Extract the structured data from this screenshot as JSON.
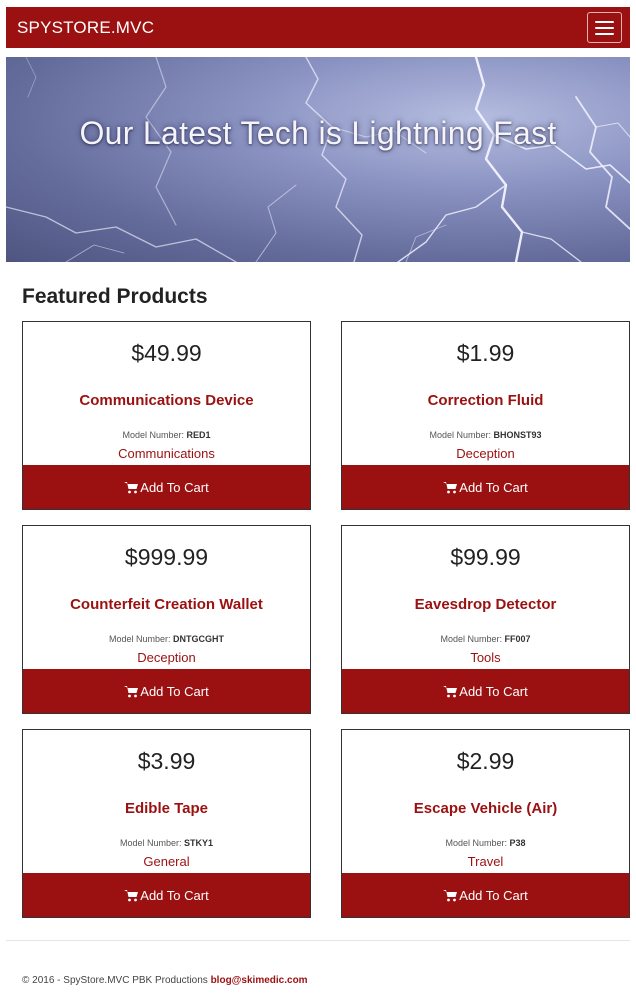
{
  "navbar": {
    "brand": "SPYSTORE.MVC"
  },
  "hero": {
    "headline": "Our Latest Tech is Lightning Fast"
  },
  "featured": {
    "title": "Featured Products",
    "model_label": "Model Number:",
    "add_to_cart_label": "Add To Cart",
    "products": [
      {
        "price": "$49.99",
        "name": "Communications Device",
        "model": "RED1",
        "category": "Communications"
      },
      {
        "price": "$1.99",
        "name": "Correction Fluid",
        "model": "BHONST93",
        "category": "Deception"
      },
      {
        "price": "$999.99",
        "name": "Counterfeit Creation Wallet",
        "model": "DNTGCGHT",
        "category": "Deception"
      },
      {
        "price": "$99.99",
        "name": "Eavesdrop Detector",
        "model": "FF007",
        "category": "Tools"
      },
      {
        "price": "$3.99",
        "name": "Edible Tape",
        "model": "STKY1",
        "category": "General"
      },
      {
        "price": "$2.99",
        "name": "Escape Vehicle (Air)",
        "model": "P38",
        "category": "Travel"
      }
    ]
  },
  "footer": {
    "text": "© 2016 - SpyStore.MVC PBK Productions",
    "email": "blog@skimedic.com"
  },
  "colors": {
    "brand": "#9b1111",
    "text": "#222222",
    "background": "#ffffff"
  },
  "icons": {
    "menu": "hamburger-icon",
    "cart": "shopping-cart-icon"
  }
}
